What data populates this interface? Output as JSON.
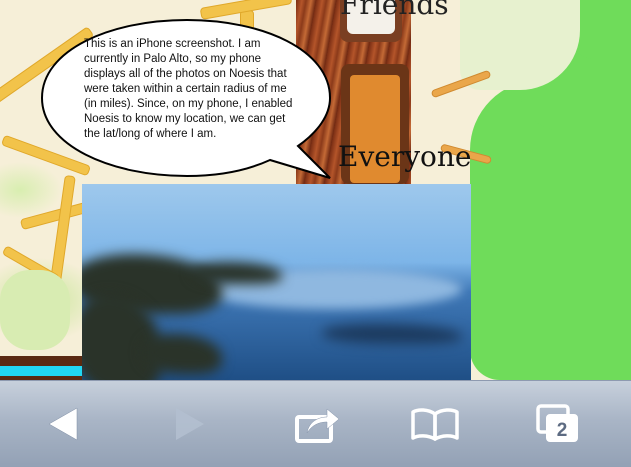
{
  "app": {
    "tabs": [
      {
        "label": "Friends"
      },
      {
        "label": "Everyone"
      }
    ]
  },
  "bubble": {
    "text": "This is an iPhone screenshot. I am currently in Palo Alto, so my phone displays all of the photos on Noesis that were taken within a certain radius of me (in miles). Since, on my phone, I enabled Noesis to know my location, we can get the lat/long of where I am."
  },
  "photo": {
    "description_icon": "coastline-photo"
  },
  "toolbar": {
    "back_icon": "back-arrow-icon",
    "forward_icon": "forward-arrow-icon",
    "share_icon": "share-icon",
    "bookmarks_icon": "bookmarks-icon",
    "tabs_icon": "tabs-icon",
    "tabs_count": "2"
  },
  "colors": {
    "accent_orange": "#e08a2f",
    "wood_brown": "#7a2e14",
    "map_green": "#6fdc5a",
    "road_yellow": "#f2c34a"
  }
}
